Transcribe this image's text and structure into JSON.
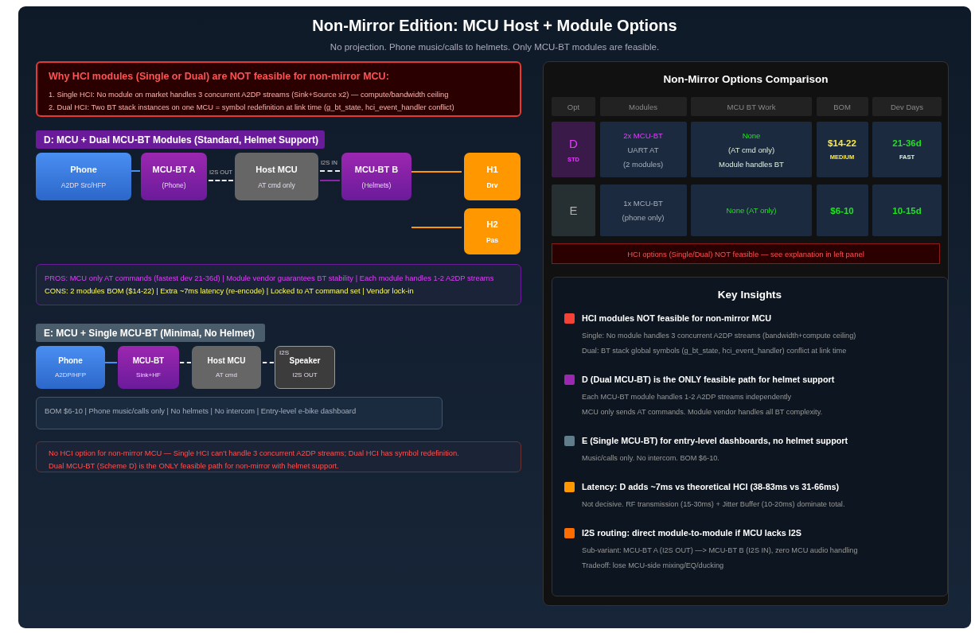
{
  "title": "Non-Mirror Edition: MCU Host + Module Options",
  "subtitle": "No projection. Phone music/calls to helmets. Only MCU-BT modules are feasible.",
  "hci_warning": {
    "title": "Why HCI modules (Single or Dual) are NOT feasible for non-mirror MCU:",
    "points": [
      "1. Single HCI: No module on market handles 3 concurrent A2DP streams (Sink+Source x2) — compute/bandwidth ceiling",
      "2. Dual HCI: Two BT stack instances on one MCU = symbol redefinition at link time (g_bt_state, hci_event_handler conflict)"
    ]
  },
  "scheme_d": {
    "header": "D: MCU + Dual MCU-BT Modules (Standard, Helmet Support)",
    "nodes": [
      {
        "kind": "phone",
        "title": "Phone",
        "subtitle": "A2DP Src/HFP"
      },
      {
        "kind": "module",
        "title": "MCU-BT A",
        "subtitle": "(Phone)"
      },
      {
        "kind": "host",
        "title": "Host MCU",
        "subtitle": "AT cmd only"
      },
      {
        "kind": "module",
        "title": "MCU-BT B",
        "subtitle": "(Helmets)"
      },
      {
        "kind": "helmet",
        "title": "H1",
        "subtitle": "Drv"
      },
      {
        "kind": "helmet",
        "title": "H2",
        "subtitle": "Pas"
      }
    ],
    "link_labels": [
      "I2S OUT",
      "I2S IN"
    ],
    "pros": "PROS: MCU only AT commands (fastest dev 21-36d) | Module vendor guarantees BT stability | Each module handles 1-2 A2DP streams",
    "cons": "CONS: 2 modules BOM ($14-22) | Extra ~7ms latency (re-encode) | Locked to AT command set | Vendor lock-in"
  },
  "scheme_e": {
    "header": "E: MCU + Single MCU-BT (Minimal, No Helmet)",
    "nodes": [
      {
        "kind": "phone",
        "title": "Phone",
        "subtitle": "A2DP/HFP"
      },
      {
        "kind": "module",
        "title": "MCU-BT",
        "subtitle": "Sink+HF"
      },
      {
        "kind": "host",
        "title": "Host MCU",
        "subtitle": "AT cmd"
      },
      {
        "kind": "speaker",
        "title": "Speaker",
        "subtitle": "I2S OUT",
        "tag": "I2S"
      }
    ],
    "summary": "BOM $6-10 | Phone music/calls only | No helmets | No intercom | Entry-level e-bike dashboard"
  },
  "conclusion": [
    "No HCI option for non-mirror MCU — Single HCI can't handle 3 concurrent A2DP streams; Dual HCI has symbol redefinition.",
    "Dual MCU-BT (Scheme D) is the ONLY feasible path for non-mirror with helmet support."
  ],
  "comparison": {
    "title": "Non-Mirror Options Comparison",
    "columns": [
      "Opt",
      "Modules",
      "MCU BT Work",
      "BOM",
      "Dev Days"
    ],
    "rows": [
      {
        "option": "D",
        "color": "#e040fb",
        "tag": "STD",
        "modules": [
          {
            "text": "2x MCU-BT",
            "kind": "magenta"
          },
          {
            "text": "UART AT",
            "kind": "muted"
          },
          {
            "text": "(2 modules)",
            "kind": "muted"
          }
        ],
        "mcu_work": [
          {
            "text": "None",
            "kind": "green"
          },
          {
            "text": "(AT cmd only)",
            "kind": "pale"
          },
          {
            "text": "Module handles BT",
            "kind": "pale"
          }
        ],
        "bom": {
          "text": "$14-22",
          "kind": "yellow"
        },
        "bom_note": {
          "text": "MEDIUM",
          "kind": "yellow"
        },
        "dev_days": {
          "text": "21-36d",
          "kind": "green"
        },
        "speed": {
          "text": "FAST",
          "kind": "pale"
        }
      },
      {
        "option": "E",
        "color": "#b0b0b0",
        "modules": [
          {
            "text": "1x MCU-BT",
            "kind": "muted"
          },
          {
            "text": "(phone only)",
            "kind": "muted"
          }
        ],
        "mcu_work": [
          {
            "text": "None (AT only)",
            "kind": "green"
          }
        ],
        "bom": {
          "text": "$6-10",
          "kind": "green"
        },
        "dev_days": {
          "text": "10-15d",
          "kind": "green"
        }
      }
    ],
    "note": "HCI options (Single/Dual) NOT feasible — see explanation in left panel"
  },
  "insights": {
    "title": "Key Insights",
    "items": [
      {
        "color": "#f44336",
        "title": "HCI modules NOT feasible for non-mirror MCU",
        "lines": [
          "Single: No module handles 3 concurrent A2DP streams (bandwidth+compute ceiling)",
          "Dual: BT stack global symbols (g_bt_state, hci_event_handler) conflict at link time"
        ]
      },
      {
        "color": "#9c27b0",
        "title": "D (Dual MCU-BT) is the ONLY feasible path for helmet support",
        "lines": [
          "Each MCU-BT module handles 1-2 A2DP streams independently",
          "MCU only sends AT commands. Module vendor handles all BT complexity."
        ]
      },
      {
        "color": "#607d8b",
        "title": "E (Single MCU-BT) for entry-level dashboards, no helmet support",
        "lines": [
          "Music/calls only. No intercom. BOM $6-10."
        ]
      },
      {
        "color": "#ff9800",
        "title": "Latency: D adds ~7ms vs theoretical HCI (38-83ms vs 31-66ms)",
        "lines": [
          "Not decisive. RF transmission (15-30ms) + Jitter Buffer (10-20ms) dominate total."
        ]
      },
      {
        "color": "#ff6d00",
        "title": "I2S routing: direct module-to-module if MCU lacks I2S",
        "lines": [
          "Sub-variant: MCU-BT A (I2S OUT) —> MCU-BT B (I2S IN), zero MCU audio handling",
          "Tradeoff: lose MCU-side mixing/EQ/ducking"
        ]
      }
    ]
  }
}
